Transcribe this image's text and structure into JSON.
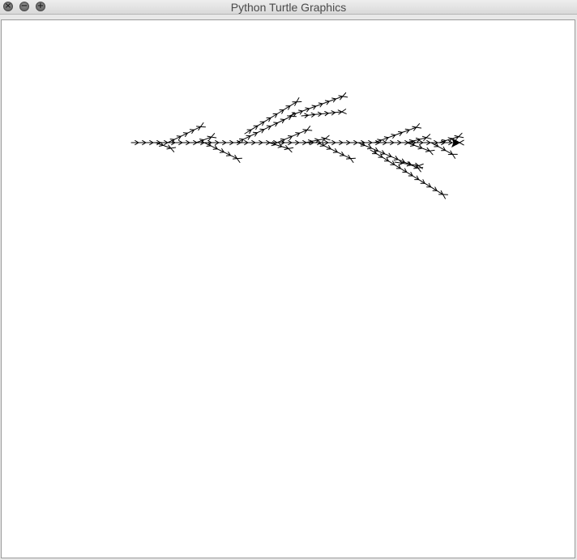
{
  "window": {
    "title": "Python Turtle Graphics",
    "controls": {
      "close_glyph": "×",
      "minimize_glyph": "−",
      "zoom_glyph": "+"
    }
  },
  "canvas": {
    "background": "#ffffff",
    "pen_color": "#000000",
    "drawing": "fractal-branching-tree",
    "turtle_cursor": "arrow-classic",
    "turtle_heading": "east"
  }
}
